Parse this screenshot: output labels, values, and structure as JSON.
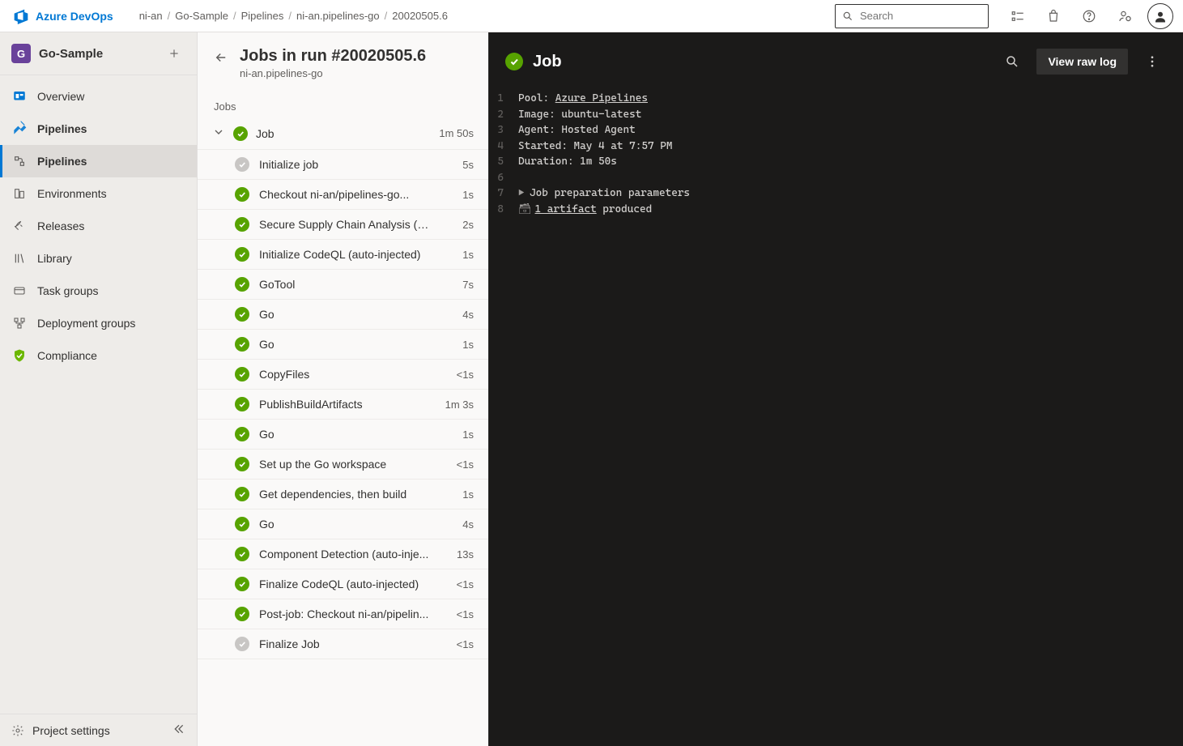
{
  "brand": "Azure DevOps",
  "breadcrumbs": [
    "ni-an",
    "Go-Sample",
    "Pipelines",
    "ni-an.pipelines-go",
    "20020505.6"
  ],
  "search": {
    "placeholder": "Search"
  },
  "project": {
    "initial": "G",
    "name": "Go-Sample"
  },
  "nav": {
    "overview": "Overview",
    "pipelines": "Pipelines",
    "sub": {
      "pipelines": "Pipelines",
      "environments": "Environments",
      "releases": "Releases",
      "library": "Library",
      "taskgroups": "Task groups",
      "deploymentgroups": "Deployment groups"
    },
    "compliance": "Compliance",
    "footer": "Project settings"
  },
  "jobs": {
    "title": "Jobs in run #20020505.6",
    "subtitle": "ni-an.pipelines-go",
    "caption": "Jobs",
    "group": {
      "name": "Job",
      "duration": "1m 50s"
    },
    "tasks": [
      {
        "status": "skip",
        "name": "Initialize job",
        "dur": "5s"
      },
      {
        "status": "ok",
        "name": "Checkout ni-an/pipelines-go...",
        "dur": "1s"
      },
      {
        "status": "ok",
        "name": "Secure Supply Chain Analysis (aut...",
        "dur": "2s"
      },
      {
        "status": "ok",
        "name": "Initialize CodeQL (auto-injected)",
        "dur": "1s"
      },
      {
        "status": "ok",
        "name": "GoTool",
        "dur": "7s"
      },
      {
        "status": "ok",
        "name": "Go",
        "dur": "4s"
      },
      {
        "status": "ok",
        "name": "Go",
        "dur": "1s"
      },
      {
        "status": "ok",
        "name": "CopyFiles",
        "dur": "<1s"
      },
      {
        "status": "ok",
        "name": "PublishBuildArtifacts",
        "dur": "1m 3s"
      },
      {
        "status": "ok",
        "name": "Go",
        "dur": "1s"
      },
      {
        "status": "ok",
        "name": "Set up the Go workspace",
        "dur": "<1s"
      },
      {
        "status": "ok",
        "name": "Get dependencies, then build",
        "dur": "1s"
      },
      {
        "status": "ok",
        "name": "Go",
        "dur": "4s"
      },
      {
        "status": "ok",
        "name": "Component Detection (auto-inje...",
        "dur": "13s"
      },
      {
        "status": "ok",
        "name": "Finalize CodeQL (auto-injected)",
        "dur": "<1s"
      },
      {
        "status": "ok",
        "name": "Post-job: Checkout ni-an/pipelin...",
        "dur": "<1s"
      },
      {
        "status": "skip",
        "name": "Finalize Job",
        "dur": "<1s"
      }
    ]
  },
  "log": {
    "title": "Job",
    "view_raw": "View raw log",
    "pool_label": "Pool: ",
    "pool_value": "Azure Pipelines",
    "image_line": "Image: ubuntu-latest",
    "agent_line": "Agent: Hosted Agent",
    "started_line": "Started: May 4 at 7:57 PM",
    "duration_line": "Duration: 1m 50s",
    "prep_line": "Job preparation parameters",
    "artifact_link": "1 artifact",
    "artifact_suffix": " produced"
  }
}
